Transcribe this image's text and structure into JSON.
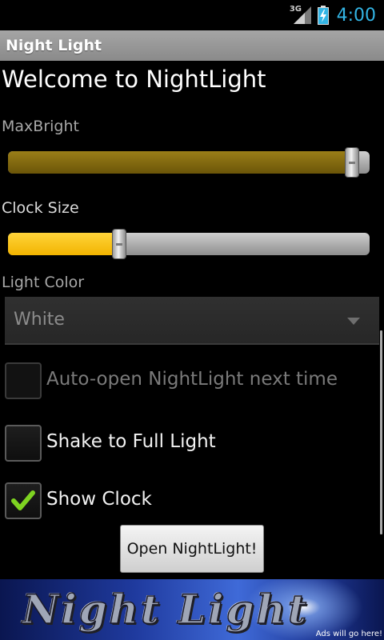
{
  "status_bar": {
    "network": "3G",
    "time": "4:00",
    "icons": [
      "signal-icon",
      "battery-charging-icon"
    ]
  },
  "title_bar": {
    "title": "Night Light"
  },
  "welcome": "Welcome to NightLight",
  "max_bright": {
    "label": "MaxBright",
    "value_fraction": 0.97
  },
  "clock_size": {
    "label": "Clock Size",
    "value_fraction": 0.3
  },
  "light_color": {
    "label": "Light Color",
    "selected": "White"
  },
  "checkboxes": [
    {
      "label": "Auto-open NightLight next time",
      "checked": false,
      "enabled": false
    },
    {
      "label": "Shake to Full Light",
      "checked": false,
      "enabled": true
    },
    {
      "label": "Show Clock",
      "checked": true,
      "enabled": true
    }
  ],
  "open_button": "Open NightLight!",
  "ad_banner": {
    "logo_text": "Night Light",
    "note": "Ads will go here!"
  },
  "colors": {
    "clock_accent": "#33b5e5",
    "max_bright_fill": "#8a6f12",
    "clock_size_fill": "#ffc800",
    "check_mark": "#7ed321"
  }
}
